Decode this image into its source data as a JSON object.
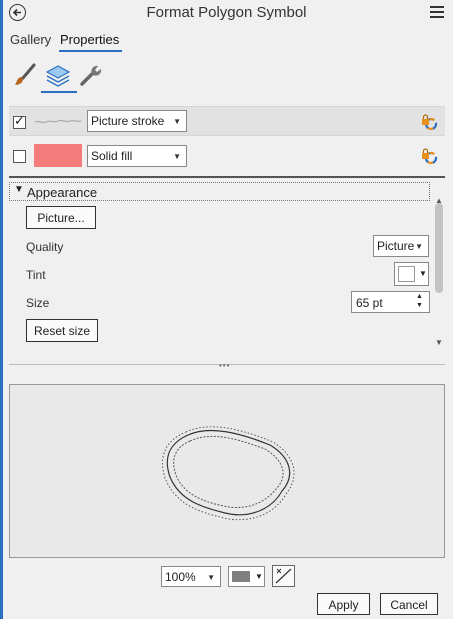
{
  "header": {
    "title": "Format Polygon Symbol"
  },
  "tabs": [
    {
      "label": "Gallery"
    },
    {
      "label": "Properties"
    }
  ],
  "layers": [
    {
      "checked": true,
      "type_label": "Picture stroke"
    },
    {
      "checked": false,
      "type_label": "Solid fill",
      "color": "#f47c7c"
    }
  ],
  "appearance": {
    "section_label": "Appearance",
    "picture_button": "Picture...",
    "quality_label": "Quality",
    "quality_value": "Picture",
    "tint_label": "Tint",
    "size_label": "Size",
    "size_value": "65 pt",
    "reset_button": "Reset size"
  },
  "footer": {
    "zoom_value": "100%",
    "apply_label": "Apply",
    "cancel_label": "Cancel"
  },
  "colors": {
    "accent": "#2b6fc0",
    "fill_swatch": "#f47c7c",
    "preview_bg": "#e9e9e9"
  }
}
